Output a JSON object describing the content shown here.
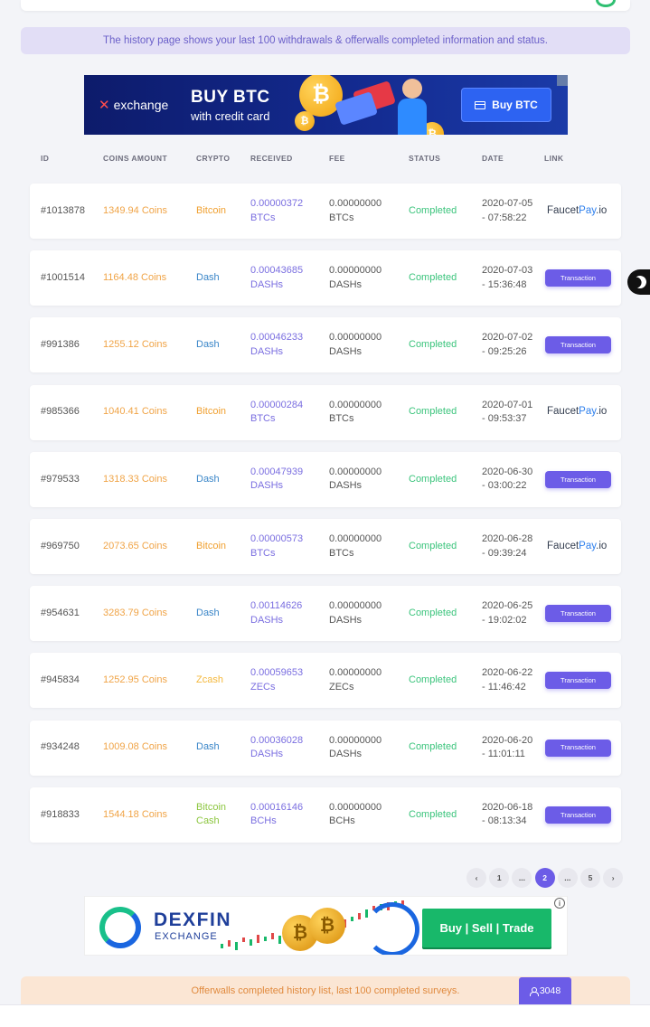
{
  "info_banner": "The history page shows your last 100 withdrawals & offerwalls completed information and status.",
  "ad_btc": {
    "brand": "exchange",
    "headline": "BUY BTC",
    "subline": "with credit card",
    "button": "Buy BTC",
    "coin_symbol": "₿"
  },
  "table": {
    "headers": [
      "ID",
      "COINS AMOUNT",
      "CRYPTO",
      "RECEIVED",
      "FEE",
      "STATUS",
      "DATE",
      "LINK"
    ],
    "rows": [
      {
        "id": "#1013878",
        "coins": "1349.94 Coins",
        "crypto": "Bitcoin",
        "crypto_key": "bitcoin",
        "received": "0.00000372 BTCs",
        "fee": "0.00000000 BTCs",
        "status": "Completed",
        "date": "2020-07-05 - 07:58:22",
        "link_type": "faucetpay"
      },
      {
        "id": "#1001514",
        "coins": "1164.48 Coins",
        "crypto": "Dash",
        "crypto_key": "dash",
        "received": "0.00043685 DASHs",
        "fee": "0.00000000 DASHs",
        "status": "Completed",
        "date": "2020-07-03 - 15:36:48",
        "link_type": "transaction"
      },
      {
        "id": "#991386",
        "coins": "1255.12 Coins",
        "crypto": "Dash",
        "crypto_key": "dash",
        "received": "0.00046233 DASHs",
        "fee": "0.00000000 DASHs",
        "status": "Completed",
        "date": "2020-07-02 - 09:25:26",
        "link_type": "transaction"
      },
      {
        "id": "#985366",
        "coins": "1040.41 Coins",
        "crypto": "Bitcoin",
        "crypto_key": "bitcoin",
        "received": "0.00000284 BTCs",
        "fee": "0.00000000 BTCs",
        "status": "Completed",
        "date": "2020-07-01 - 09:53:37",
        "link_type": "faucetpay"
      },
      {
        "id": "#979533",
        "coins": "1318.33 Coins",
        "crypto": "Dash",
        "crypto_key": "dash",
        "received": "0.00047939 DASHs",
        "fee": "0.00000000 DASHs",
        "status": "Completed",
        "date": "2020-06-30 - 03:00:22",
        "link_type": "transaction"
      },
      {
        "id": "#969750",
        "coins": "2073.65 Coins",
        "crypto": "Bitcoin",
        "crypto_key": "bitcoin",
        "received": "0.00000573 BTCs",
        "fee": "0.00000000 BTCs",
        "status": "Completed",
        "date": "2020-06-28 - 09:39:24",
        "link_type": "faucetpay"
      },
      {
        "id": "#954631",
        "coins": "3283.79 Coins",
        "crypto": "Dash",
        "crypto_key": "dash",
        "received": "0.00114626 DASHs",
        "fee": "0.00000000 DASHs",
        "status": "Completed",
        "date": "2020-06-25 - 19:02:02",
        "link_type": "transaction"
      },
      {
        "id": "#945834",
        "coins": "1252.95 Coins",
        "crypto": "Zcash",
        "crypto_key": "zcash",
        "received": "0.00059653 ZECs",
        "fee": "0.00000000 ZECs",
        "status": "Completed",
        "date": "2020-06-22 - 11:46:42",
        "link_type": "transaction"
      },
      {
        "id": "#934248",
        "coins": "1009.08 Coins",
        "crypto": "Dash",
        "crypto_key": "dash",
        "received": "0.00036028 DASHs",
        "fee": "0.00000000 DASHs",
        "status": "Completed",
        "date": "2020-06-20 - 11:01:11",
        "link_type": "transaction"
      },
      {
        "id": "#918833",
        "coins": "1544.18 Coins",
        "crypto": "Bitcoin Cash",
        "crypto_key": "bch",
        "received": "0.00016146 BCHs",
        "fee": "0.00000000 BCHs",
        "status": "Completed",
        "date": "2020-06-18 - 08:13:34",
        "link_type": "transaction"
      }
    ],
    "transaction_label": "Transaction",
    "faucetpay_label": {
      "part1": "Faucet",
      "part2": "Pay",
      "part3": ".io"
    }
  },
  "pagination": {
    "prev": "‹",
    "pages": [
      "1",
      "...",
      "2",
      "...",
      "5"
    ],
    "active_index": 2,
    "next": "›"
  },
  "ad_dexfin": {
    "brand": "DEXFIN",
    "sub": "EXCHANGE",
    "button": "Buy | Sell | Trade",
    "info": "i",
    "coin_symbol": "₿"
  },
  "offer_banner": "Offerwalls completed history list, last 100 completed surveys.",
  "online_count": "3048",
  "colors": {
    "accent": "#6c5ce7",
    "completed": "#3bc47c",
    "coins": "#f0a447"
  }
}
